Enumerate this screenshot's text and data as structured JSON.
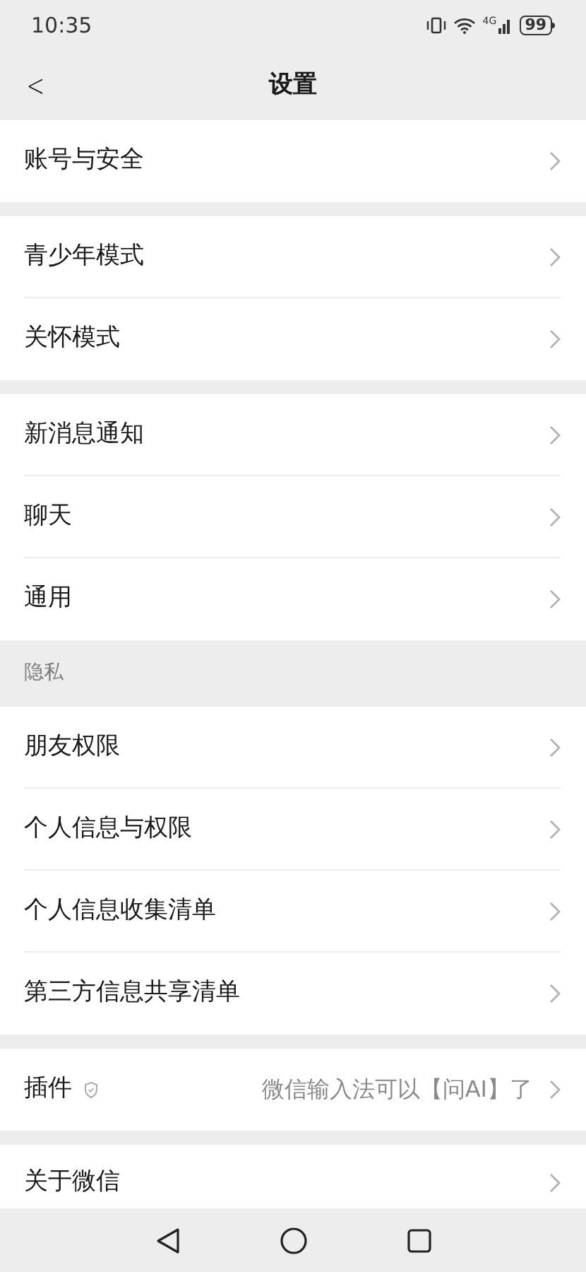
{
  "status_bar": {
    "time": "10:35",
    "network": "4G",
    "battery": "99"
  },
  "header": {
    "back": "<",
    "title": "设置"
  },
  "groups": [
    {
      "items": [
        {
          "label": "账号与安全"
        }
      ]
    },
    {
      "items": [
        {
          "label": "青少年模式"
        },
        {
          "label": "关怀模式"
        }
      ]
    },
    {
      "items": [
        {
          "label": "新消息通知"
        },
        {
          "label": "聊天"
        },
        {
          "label": "通用"
        }
      ]
    },
    {
      "header": "隐私",
      "items": [
        {
          "label": "朋友权限"
        },
        {
          "label": "个人信息与权限"
        },
        {
          "label": "个人信息收集清单"
        },
        {
          "label": "第三方信息共享清单"
        }
      ]
    },
    {
      "items": [
        {
          "label": "插件",
          "badge": true,
          "note": "微信输入法可以【问AI】了"
        }
      ]
    },
    {
      "items": [
        {
          "label": "关于微信"
        }
      ]
    }
  ]
}
